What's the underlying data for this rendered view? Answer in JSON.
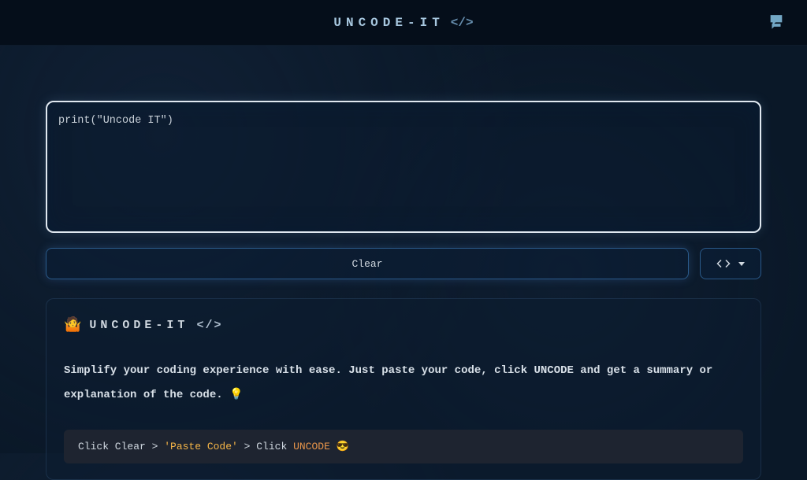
{
  "header": {
    "logo_text": "UNCODE-IT",
    "logo_suffix": "</>"
  },
  "editor": {
    "placeholder": "print(\"Uncode IT\")",
    "value": ""
  },
  "controls": {
    "clear_label": "Clear"
  },
  "panel": {
    "title_emoji": "🤷",
    "title_text": "UNCODE-IT",
    "title_suffix": "</>",
    "description": "Simplify your coding experience with ease. Just paste your code, click UNCODE and get a summary or explanation of the code. 💡",
    "hint_prefix": "Click Clear > ",
    "hint_paste": "'Paste Code'",
    "hint_mid": " > Click ",
    "hint_uncode": "UNCODE",
    "hint_suffix": " 😎"
  }
}
